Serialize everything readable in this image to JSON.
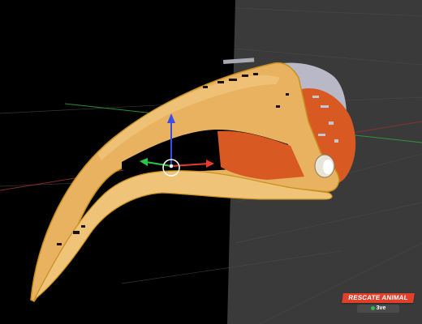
{
  "scene": {
    "description_tag": "3d-viewport",
    "colors": {
      "void": "#000000",
      "grid_plane": "#3a3a3a",
      "beak_main": "#e8b260",
      "beak_inner": "#f0c478",
      "beak_edge": "#c8901e",
      "inner_flesh": "#d85a22",
      "skull_gray": "#b8b8c6",
      "axis_red": "#c23a3a",
      "axis_green": "#2e9d3c",
      "gizmo_blue": "#3a4fe8",
      "gizmo_green": "#28c846",
      "gizmo_red": "#e63b2e"
    }
  },
  "logo": {
    "top_text": "RESCATE ANIMAL",
    "bottom_text": "3ve",
    "colors": {
      "banner": "#e0402a",
      "dot": "#2dbb52"
    }
  }
}
